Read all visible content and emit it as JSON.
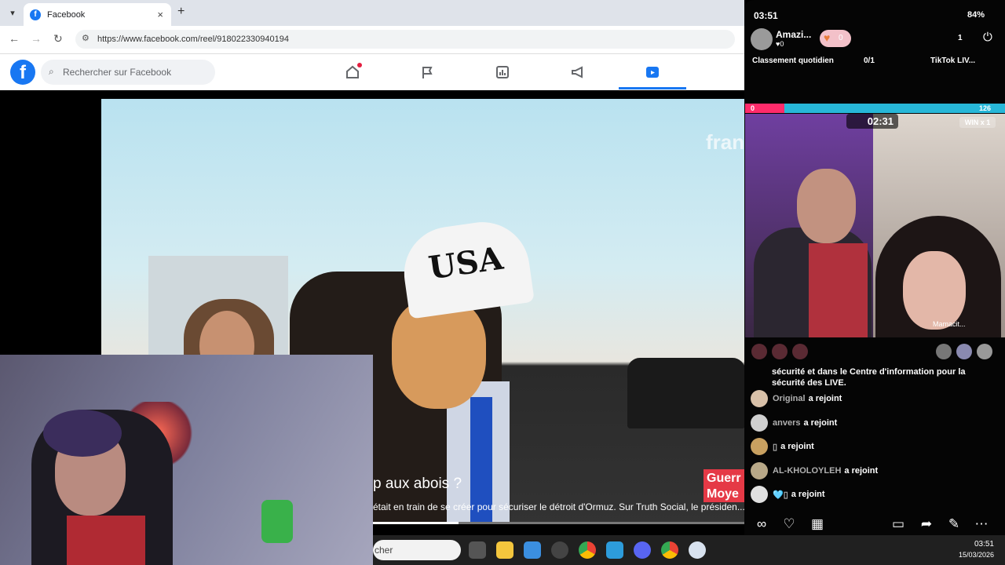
{
  "browser": {
    "tab_title": "Facebook",
    "tab_close": "×",
    "new_tab": "+",
    "menu": "▾",
    "back": "←",
    "forward": "→",
    "reload": "↻",
    "url": "https://www.facebook.com/reel/918022330940194"
  },
  "facebook": {
    "logo": "f",
    "search_placeholder": "Rechercher sur Facebook"
  },
  "video": {
    "brand": "fran",
    "hat_text": "USA",
    "headline": "p aux abois ?",
    "ticker": "était en train de se créer pour sécuriser le détroit d'Ormuz. Sur Truth Social, le présiden...",
    "badge_line1": "Guerr",
    "badge_line2": "Moye",
    "progress": 0.23
  },
  "taskbar": {
    "search_text": "cher",
    "time": "03:51",
    "date": "15/03/2026"
  },
  "tiktok": {
    "status_time": "03:51",
    "battery": "84%",
    "streamer_name": "Amazi...",
    "streamer_sub": "♥0",
    "follow_count": "0",
    "viewers": "1",
    "rank_label": "Classement quotidien",
    "score": "0/1",
    "tiktok_live": "TikTok LIV...",
    "battle_left": "0",
    "battle_right": "126",
    "timer": "02:31",
    "win": "WIN x 1",
    "muted_label": "Mamacit...",
    "message": "sécurité et dans le Centre d'information pour la sécurité des LIVE.",
    "joins": [
      {
        "name": "Original",
        "action": "a rejoint"
      },
      {
        "name": "anvers",
        "action": "a rejoint"
      },
      {
        "name": "▯",
        "action": "a rejoint"
      },
      {
        "name": "AL-KHOLOYLEH",
        "action": "a rejoint"
      },
      {
        "name": "🩵▯",
        "action": "a rejoint"
      }
    ]
  }
}
